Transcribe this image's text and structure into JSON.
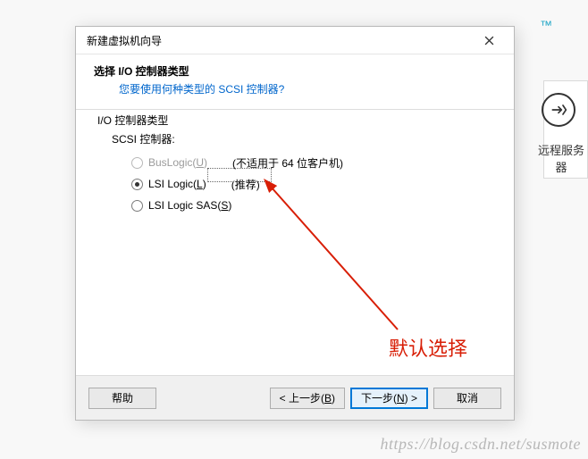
{
  "background": {
    "tm": "™",
    "side_label": "远程服务器"
  },
  "dialog": {
    "title": "新建虚拟机向导",
    "header_title": "选择 I/O 控制器类型",
    "header_sub": "您要使用何种类型的 SCSI 控制器?",
    "group_label": "I/O 控制器类型",
    "scsi_label": "SCSI 控制器:",
    "options": [
      {
        "label_pre": "BusLogic(",
        "hotkey": "U",
        "label_post": ")",
        "note": "(不适用于 64 位客户机)",
        "disabled": true,
        "selected": false
      },
      {
        "label_pre": "LSI Logic(",
        "hotkey": "L",
        "label_post": ")",
        "note": "(推荐)",
        "disabled": false,
        "selected": true
      },
      {
        "label_pre": "LSI Logic SAS(",
        "hotkey": "S",
        "label_post": ")",
        "note": "",
        "disabled": false,
        "selected": false
      }
    ],
    "annotation": "默认选择",
    "buttons": {
      "help": "帮助",
      "back_pre": "< 上一步(",
      "back_hot": "B",
      "back_post": ")",
      "next_pre": "下一步(",
      "next_hot": "N",
      "next_post": ") >",
      "cancel": "取消"
    }
  },
  "watermark": "https://blog.csdn.net/susmote"
}
